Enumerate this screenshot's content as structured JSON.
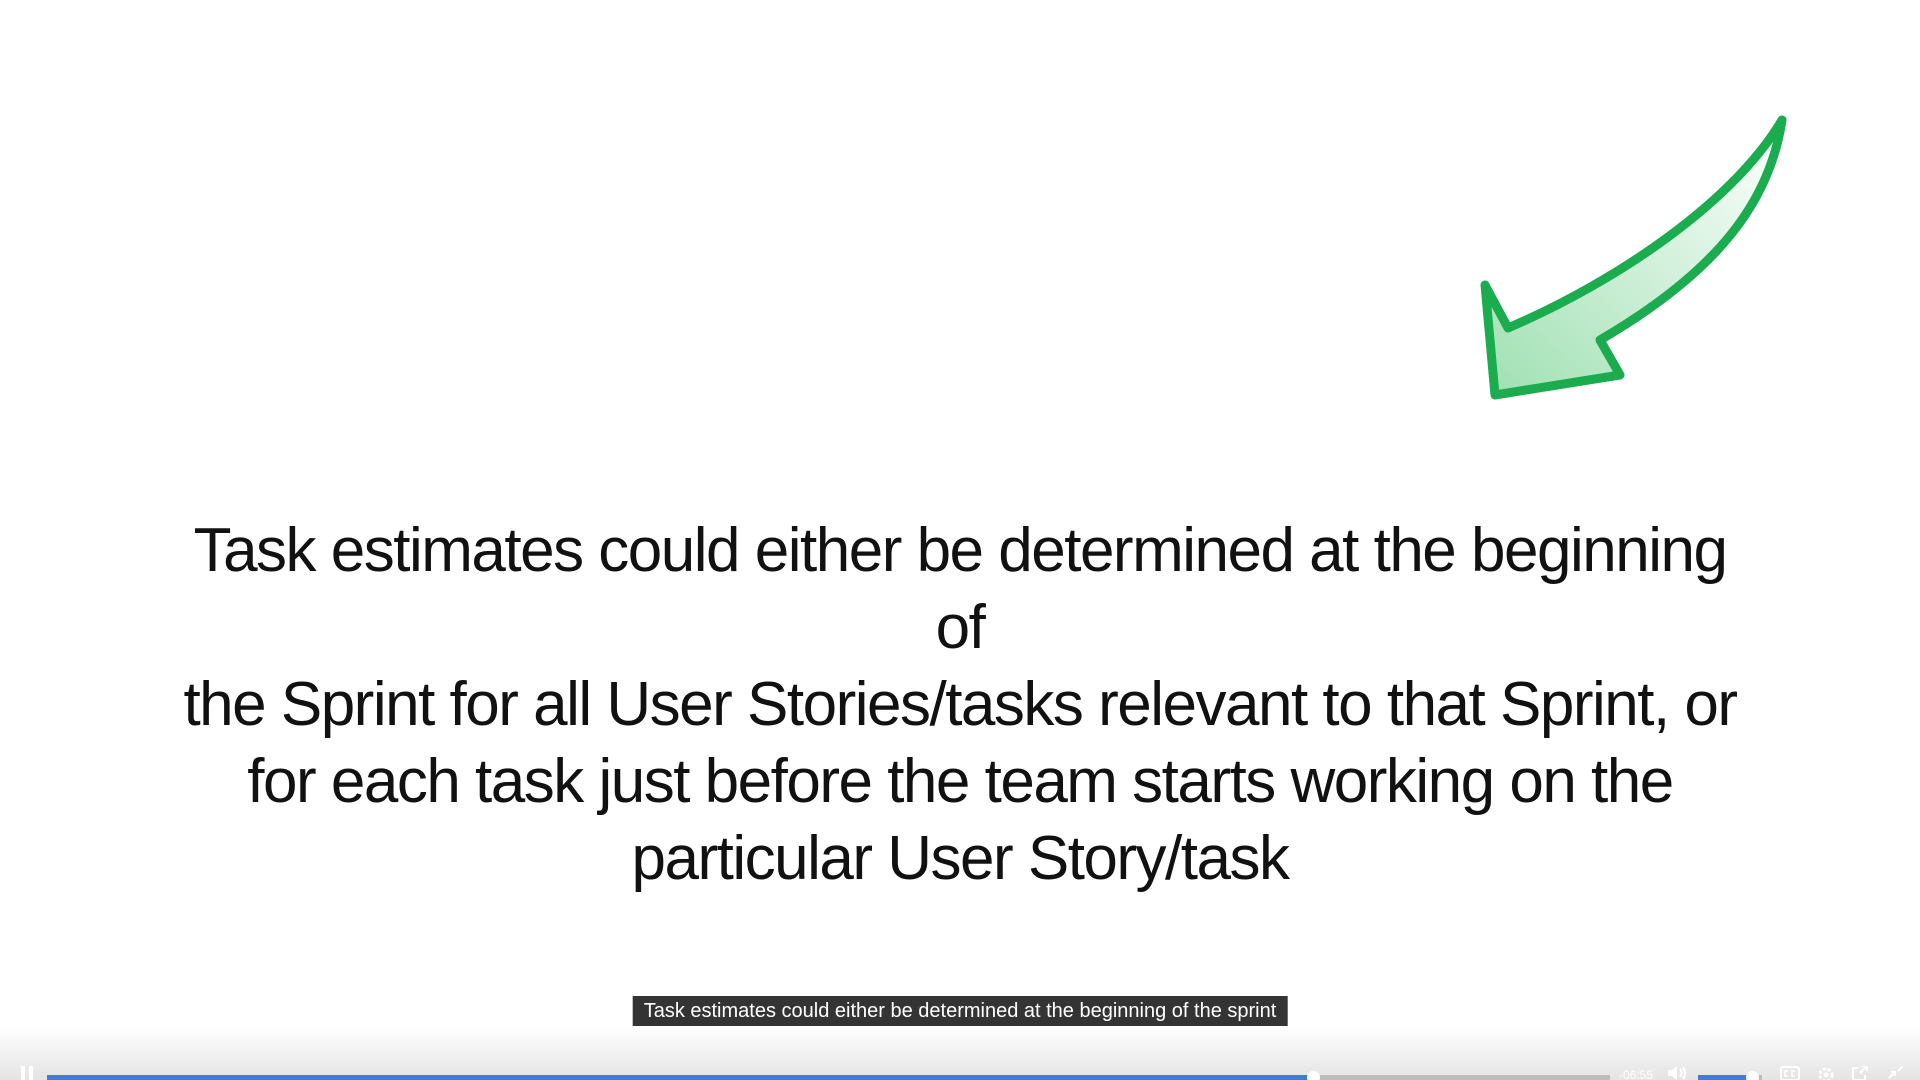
{
  "slide": {
    "lines": [
      "Task estimates could either be determined at the beginning of",
      "the Sprint for all User Stories/tasks relevant to that Sprint, or",
      "for each task just before the team starts working on the",
      "particular User Story/task"
    ],
    "arrow_color": "#1aac4f"
  },
  "caption": {
    "text": "Task estimates could either be determined at the beginning of the sprint"
  },
  "player": {
    "progress_fraction": 0.81,
    "volume_fraction": 0.85,
    "time_remaining": "-06:55",
    "accent_color": "#3d7ed8",
    "icons": {
      "play_pause": "pause-icon",
      "volume": "volume-icon",
      "captions": "closed-captions-icon",
      "settings": "gear-icon",
      "popout": "popout-icon",
      "exit_fullscreen": "exit-fullscreen-icon"
    }
  }
}
